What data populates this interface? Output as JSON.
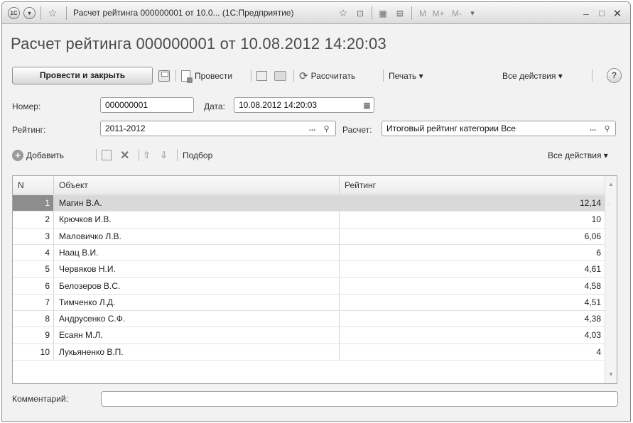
{
  "window": {
    "title": "Расчет рейтинга 000000001 от 10.0...  (1С:Предприятие)",
    "app_badge": "1C",
    "toolbar_glyphs": {
      "m": "M",
      "m_plus": "M+",
      "m_minus": "M-"
    }
  },
  "form": {
    "heading": "Расчет рейтинга 000000001 от 10.08.2012 14:20:03"
  },
  "commands": {
    "post_and_close": "Провести и закрыть",
    "post": "Провести",
    "calculate": "Рассчитать",
    "print": "Печать ▾",
    "all_actions": "Все действия ▾",
    "help": "?"
  },
  "fields": {
    "number_label": "Номер:",
    "number_value": "000000001",
    "date_label": "Дата:",
    "date_value": "10.08.2012 14:20:03",
    "rating_label": "Рейтинг:",
    "rating_value": "2011-2012",
    "calc_label": "Расчет:",
    "calc_value": "Итоговый рейтинг категории Все",
    "select_dots": "..."
  },
  "table_commands": {
    "add": "Добавить",
    "pick": "Подбор",
    "all_actions": "Все действия ▾"
  },
  "table": {
    "columns": [
      "N",
      "Объект",
      "Рейтинг"
    ],
    "rows": [
      {
        "n": "1",
        "object": "Магин В.А.",
        "rating": "12,14"
      },
      {
        "n": "2",
        "object": "Крючков И.В.",
        "rating": "10"
      },
      {
        "n": "3",
        "object": "Маловичко Л.В.",
        "rating": "6,06"
      },
      {
        "n": "4",
        "object": "Наац В.И.",
        "rating": "6"
      },
      {
        "n": "5",
        "object": "Червяков Н.И.",
        "rating": "4,61"
      },
      {
        "n": "6",
        "object": "Белозеров В.С.",
        "rating": "4,58"
      },
      {
        "n": "7",
        "object": "Тимченко Л.Д.",
        "rating": "4,51"
      },
      {
        "n": "8",
        "object": "Андрусенко С.Ф.",
        "rating": "4,38"
      },
      {
        "n": "9",
        "object": "Есаян М.Л.",
        "rating": "4,03"
      },
      {
        "n": "10",
        "object": "Лукьяненко В.П.",
        "rating": "4"
      }
    ],
    "selected_row": 0
  },
  "comment": {
    "label": "Комментарий:",
    "value": ""
  }
}
